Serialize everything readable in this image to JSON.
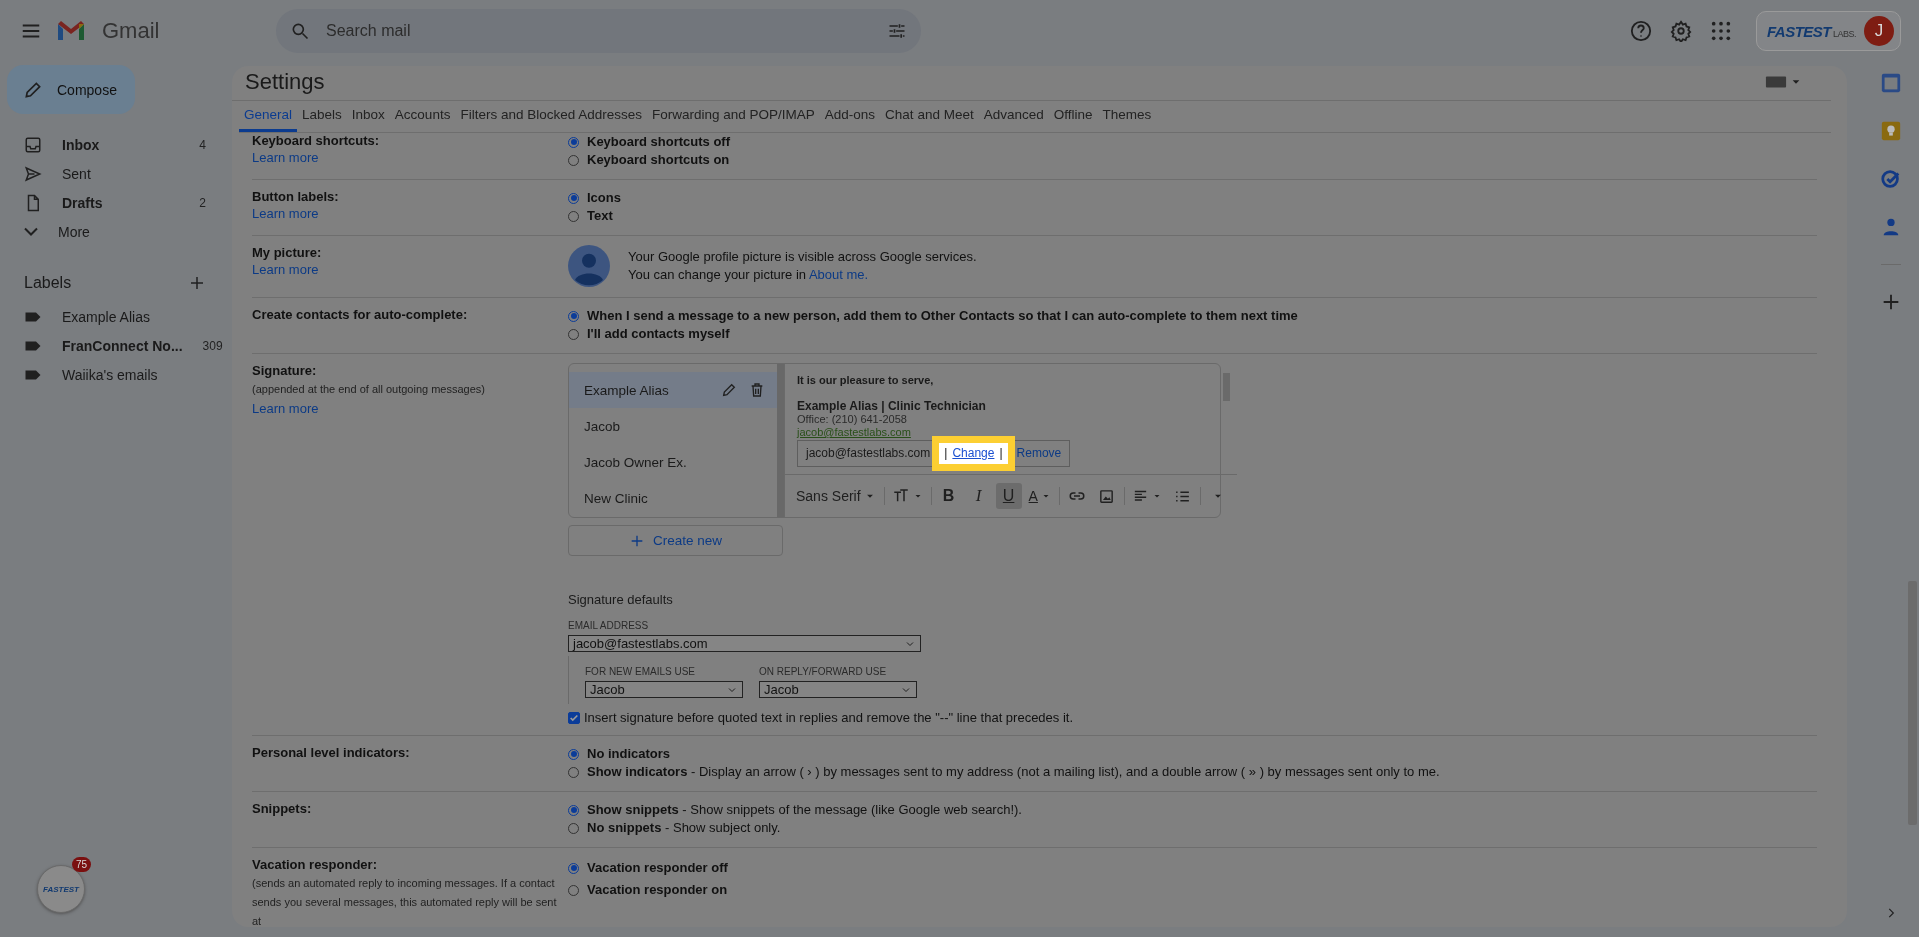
{
  "topbar": {
    "app_name": "Gmail",
    "search_placeholder": "Search mail",
    "brand_logo": "FASTEST",
    "brand_suffix": "LABS.",
    "avatar_initial": "J"
  },
  "sidebar": {
    "compose": "Compose",
    "items": [
      {
        "kind": "inbox",
        "label": "Inbox",
        "count": "4",
        "unread": true
      },
      {
        "kind": "sent",
        "label": "Sent",
        "unread": false
      },
      {
        "kind": "drafts",
        "label": "Drafts",
        "count": "2",
        "unread": true
      },
      {
        "kind": "more",
        "label": "More",
        "unread": false
      }
    ],
    "labels_title": "Labels",
    "labels": [
      {
        "label": "Example Alias",
        "unread": false
      },
      {
        "label": "FranConnect No...",
        "count": "309",
        "unread": true
      },
      {
        "label": "Waiika's emails",
        "unread": false
      }
    ]
  },
  "settings": {
    "title": "Settings",
    "tabs": [
      {
        "label": "General",
        "selected": true
      },
      {
        "label": "Labels",
        "selected": false
      },
      {
        "label": "Inbox",
        "selected": false
      },
      {
        "label": "Accounts",
        "selected": false
      },
      {
        "label": "Filters and Blocked Addresses",
        "selected": false
      },
      {
        "label": "Forwarding and POP/IMAP",
        "selected": false
      },
      {
        "label": "Add-ons",
        "selected": false
      },
      {
        "label": "Chat and Meet",
        "selected": false
      },
      {
        "label": "Advanced",
        "selected": false
      },
      {
        "label": "Offline",
        "selected": false
      },
      {
        "label": "Themes",
        "selected": false
      }
    ],
    "rows": [
      {
        "kind": "radio",
        "label": "Keyboard shortcuts:",
        "learn_more": "Learn more",
        "options": [
          {
            "label": "Keyboard shortcuts off",
            "selected": true
          },
          {
            "label": "Keyboard shortcuts on",
            "selected": false
          }
        ]
      },
      {
        "kind": "radio",
        "label": "Button labels:",
        "learn_more": "Learn more",
        "options": [
          {
            "label": "Icons",
            "selected": true
          },
          {
            "label": "Text",
            "selected": false
          }
        ]
      },
      {
        "kind": "picture",
        "label": "My picture:",
        "learn_more": "Learn more",
        "line_1": "Your Google profile picture is visible across Google services.",
        "line_2": "You can change your picture in",
        "link": "About me."
      },
      {
        "kind": "radio",
        "label": "Create contacts for auto-complete:",
        "options": [
          {
            "label": "When I send a message to a new person, add them to Other Contacts so that I can auto-complete to them next time",
            "selected": true
          },
          {
            "label": "I'll add contacts myself",
            "selected": false
          }
        ]
      },
      {
        "kind": "signature",
        "label": "Signature:",
        "note": "(appended at the end of all outgoing messages)",
        "learn_more": "Learn more",
        "signatures": [
          {
            "name": "Example Alias",
            "selected": true
          },
          {
            "name": "Jacob",
            "selected": false
          },
          {
            "name": "Jacob Owner Ex.",
            "selected": false
          },
          {
            "name": "New Clinic",
            "selected": false
          }
        ],
        "editor": {
          "greeting": "It is our pleasure to serve,",
          "name_line": "Example Alias | Clinic Technician",
          "office": "Office: (210) 641-2058",
          "email": "jacob@fastestlabs.com",
          "link_popup": {
            "address": "jacob@fastestlabs.com",
            "separator": "|",
            "change": "Change",
            "remove": "Remove"
          },
          "toolbar": [
            {
              "kind": "font",
              "label": "Sans Serif"
            },
            {
              "kind": "size"
            },
            {
              "kind": "bold",
              "glyph": "B",
              "active": false
            },
            {
              "kind": "italic",
              "glyph": "I",
              "active": false
            },
            {
              "kind": "underline",
              "glyph": "U",
              "active": true
            },
            {
              "kind": "color",
              "glyph": "A"
            },
            {
              "kind": "link"
            },
            {
              "kind": "image"
            },
            {
              "kind": "align"
            },
            {
              "kind": "list"
            },
            {
              "kind": "more"
            }
          ]
        },
        "create_new": "Create new",
        "defaults": {
          "title": "Signature defaults",
          "email_label": "EMAIL ADDRESS",
          "email_value": "jacob@fastestlabs.com",
          "new_label": "FOR NEW EMAILS USE",
          "new_value": "Jacob",
          "reply_label": "ON REPLY/FORWARD USE",
          "reply_value": "Jacob",
          "insert_text": "Insert signature before quoted text in replies and remove the \"--\" line that precedes it.",
          "insert_checked": true
        }
      },
      {
        "kind": "radio",
        "label": "Personal level indicators:",
        "options": [
          {
            "label": "No indicators",
            "selected": true
          },
          {
            "label": "Show indicators",
            "description": "- Display an arrow ( › ) by messages sent to my address (not a mailing list), and a double arrow ( » ) by messages sent only to me.",
            "selected": false
          }
        ]
      },
      {
        "kind": "radio",
        "label": "Snippets:",
        "options": [
          {
            "label": "Show snippets",
            "description": "- Show snippets of the message (like Google web search!).",
            "selected": true
          },
          {
            "label": "No snippets",
            "description": "- Show subject only.",
            "selected": false
          }
        ]
      },
      {
        "kind": "radio",
        "label": "Vacation responder:",
        "note": "(sends an automated reply to incoming messages. If a contact sends you several messages, this automated reply will be sent at",
        "options": [
          {
            "label": "Vacation responder off",
            "selected": true
          },
          {
            "label": "Vacation responder on",
            "selected": false
          }
        ]
      }
    ]
  },
  "floating_badge": {
    "logo": "FASTEST",
    "count": "75"
  }
}
